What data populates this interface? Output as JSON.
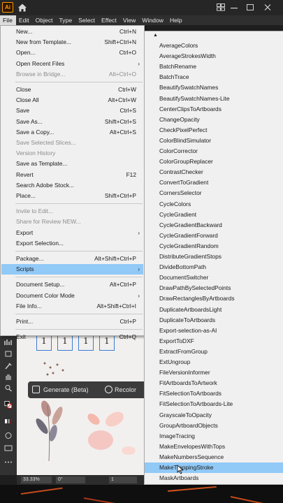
{
  "app": {
    "logo_text": "Ai",
    "accent": "#ff9a00"
  },
  "menubar": [
    "File",
    "Edit",
    "Object",
    "Type",
    "Select",
    "Effect",
    "View",
    "Window",
    "Help"
  ],
  "file_menu": [
    {
      "label": "New...",
      "shortcut": "Ctrl+N"
    },
    {
      "label": "New from Template...",
      "shortcut": "Shift+Ctrl+N"
    },
    {
      "label": "Open...",
      "shortcut": "Ctrl+O"
    },
    {
      "label": "Open Recent Files",
      "submenu": true
    },
    {
      "label": "Browse in Bridge...",
      "shortcut": "Alt+Ctrl+O",
      "disabled": true
    },
    {
      "separator": true
    },
    {
      "label": "Close",
      "shortcut": "Ctrl+W"
    },
    {
      "label": "Close All",
      "shortcut": "Alt+Ctrl+W"
    },
    {
      "label": "Save",
      "shortcut": "Ctrl+S"
    },
    {
      "label": "Save As...",
      "shortcut": "Shift+Ctrl+S"
    },
    {
      "label": "Save a Copy...",
      "shortcut": "Alt+Ctrl+S"
    },
    {
      "label": "Save Selected Slices...",
      "disabled": true
    },
    {
      "label": "Version History",
      "disabled": true
    },
    {
      "label": "Save as Template..."
    },
    {
      "label": "Revert",
      "shortcut": "F12"
    },
    {
      "label": "Search Adobe Stock..."
    },
    {
      "label": "Place...",
      "shortcut": "Shift+Ctrl+P"
    },
    {
      "separator": true
    },
    {
      "label": "Invite to Edit...",
      "disabled": true
    },
    {
      "label": "Share for Review NEW...",
      "disabled": true
    },
    {
      "label": "Export",
      "submenu": true
    },
    {
      "label": "Export Selection..."
    },
    {
      "separator": true
    },
    {
      "label": "Package...",
      "shortcut": "Alt+Shift+Ctrl+P"
    },
    {
      "label": "Scripts",
      "submenu": true,
      "highlighted": true
    },
    {
      "separator": true
    },
    {
      "label": "Document Setup...",
      "shortcut": "Alt+Ctrl+P"
    },
    {
      "label": "Document Color Mode",
      "submenu": true
    },
    {
      "label": "File Info...",
      "shortcut": "Alt+Shift+Ctrl+I"
    },
    {
      "separator": true
    },
    {
      "label": "Print...",
      "shortcut": "Ctrl+P"
    },
    {
      "separator": true
    },
    {
      "label": "Exit",
      "shortcut": "Ctrl+Q"
    }
  ],
  "scripts_menu": {
    "highlighted_index": 40,
    "items": [
      "AverageColors",
      "AverageStrokesWidth",
      "BatchRename",
      "BatchTrace",
      "BeautifySwatchNames",
      "BeautifySwatchNames-Lite",
      "CenterClipsToArtboards",
      "ChangeOpacity",
      "CheckPixelPerfect",
      "ColorBlindSimulator",
      "ColorCorrector",
      "ColorGroupReplacer",
      "ContrastChecker",
      "ConvertToGradient",
      "CornersSelector",
      "CycleColors",
      "CycleGradient",
      "CycleGradientBackward",
      "CycleGradientForward",
      "CycleGradientRandom",
      "DistributeGradientStops",
      "DivideBottomPath",
      "DocumentSwitcher",
      "DrawPathBySelectedPoints",
      "DrawRectanglesByArtboards",
      "DuplicateArtboardsLight",
      "DuplicateToArtboards",
      "Export-selection-as-AI",
      "ExportToDXF",
      "ExtractFromGroup",
      "ExtUngroup",
      "FileVersionInformer",
      "FitArtboardsToArtwork",
      "FitSelectionToArtboards",
      "FitSelectionToArtboards-Lite",
      "GrayscaleToOpacity",
      "GroupArtboardObjects",
      "ImageTracing",
      "MakeEnvelopesWithTops",
      "MakeNumbersSequence",
      "MakeTrappingStroke",
      "MaskArtboards"
    ]
  },
  "canvas": {
    "artboard_numbers": [
      "1",
      "1",
      "1",
      "1"
    ],
    "generate_label": "Generate (Beta)",
    "recolor_label": "Recolor"
  },
  "statusbar": {
    "zoom": "33.33%",
    "rotation": "0°",
    "artboard": "1"
  }
}
